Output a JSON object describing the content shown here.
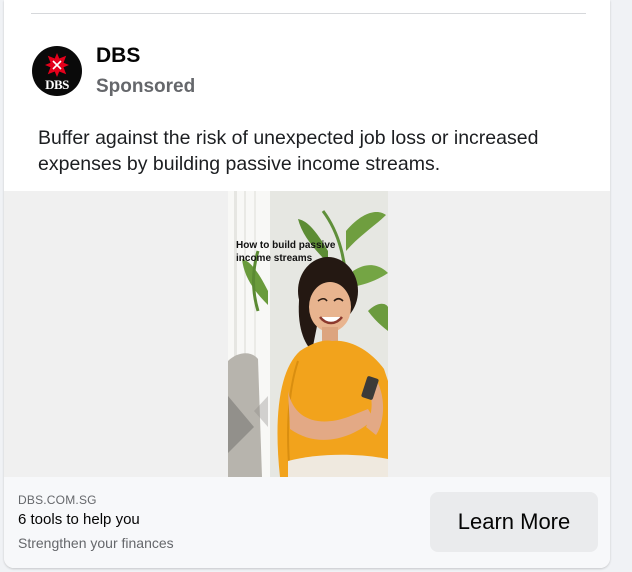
{
  "post": {
    "page_name": "DBS",
    "sponsored_label": "Sponsored",
    "ad_text": "Buffer against the risk of unexpected job loss or increased expenses by building passive income streams.",
    "avatar_text": "DBS"
  },
  "media": {
    "caption": "How to build passive income streams"
  },
  "footer": {
    "domain": "DBS.COM.SG",
    "headline": "6 tools to help you",
    "description": "Strengthen your finances",
    "cta_label": "Learn More"
  },
  "colors": {
    "brand_red": "#e3001b",
    "shirt": "#f2a31c"
  }
}
